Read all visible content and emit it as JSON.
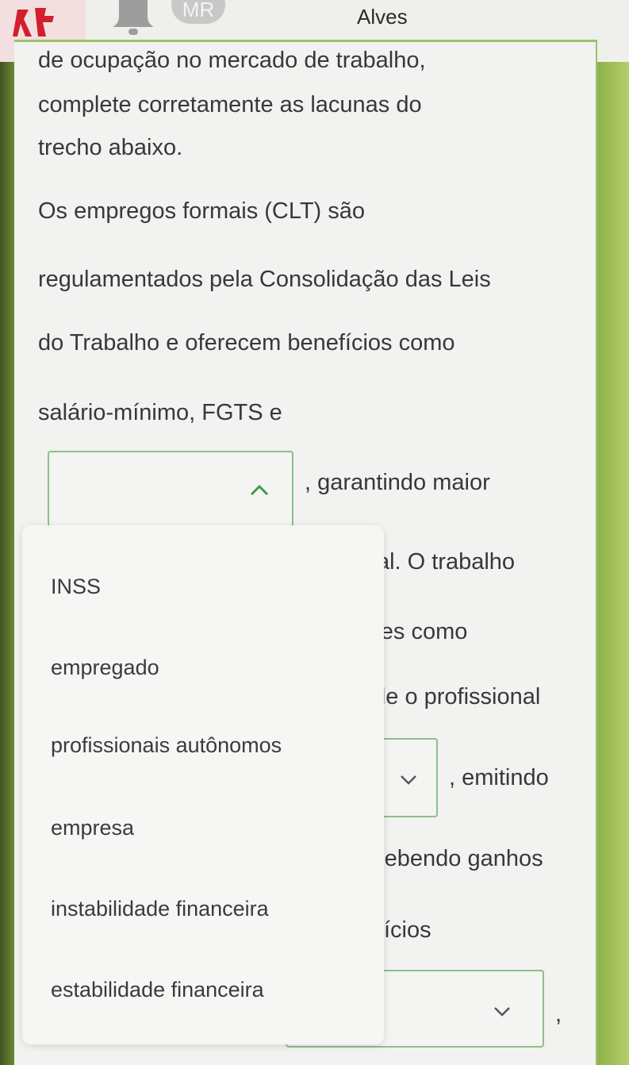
{
  "header": {
    "avatar_initials": "MR",
    "user_name": "Alves"
  },
  "question": {
    "intro_lines": [
      "de ocupação no mercado de trabalho,",
      "complete corretamente as lacunas do",
      "trecho abaixo."
    ],
    "passage_lines": [
      "Os empregos formais (CLT) são",
      "regulamentados pela Consolidação das Leis",
      "do Trabalho e oferecem benefícios como",
      "salário-mínimo, FGTS e"
    ],
    "after_blank1": ", garantindo maior",
    "fragments": {
      "line1": "cial. O trabalho",
      "line2": "ores como",
      "line3": "nde o profissional",
      "after_blank2": ", emitindo",
      "line5": "ecebendo ganhos",
      "line6": "ícios",
      "after_blank3": ","
    }
  },
  "dropdown": {
    "options": [
      "INSS",
      "empregado",
      "profissionais autônomos",
      "empresa",
      "instabilidade financeira",
      "estabilidade financeira"
    ]
  },
  "colors": {
    "accent_green": "#8cc08a",
    "brand_red": "#d21f2d"
  }
}
